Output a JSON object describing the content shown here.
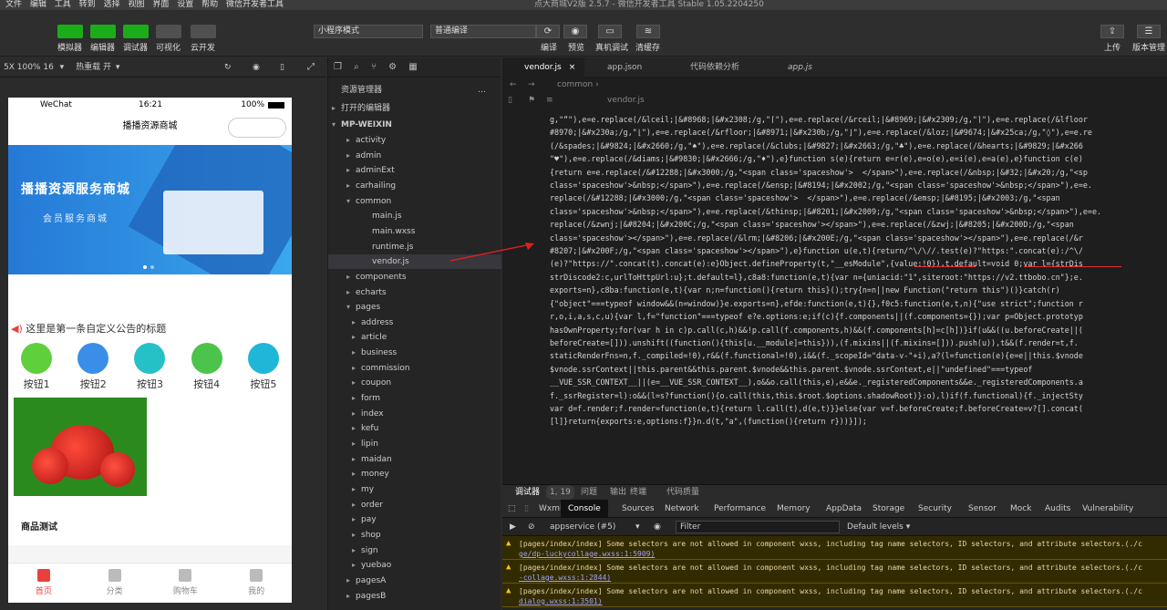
{
  "menubar": {
    "items": [
      "文件",
      "编辑",
      "工具",
      "转到",
      "选择",
      "视图",
      "界面",
      "设置",
      "帮助",
      "微信开发者工具"
    ],
    "title": "点大商城V2版 2.5.7 - 微信开发者工具 Stable 1.05.2204250"
  },
  "toolbar": {
    "left_labels": [
      "模拟器",
      "编辑器",
      "调试器",
      "可视化",
      "云开发"
    ],
    "mode_select": "小程序模式",
    "compile_select": "普通编译",
    "mid_labels": [
      "编译",
      "预览",
      "真机调试",
      "清缓存"
    ],
    "right_labels": [
      "上传",
      "版本管理"
    ]
  },
  "simbar": {
    "device": "5X 100% 16",
    "hotreload": "热重载 开"
  },
  "phone": {
    "carrier": "WeChat",
    "time": "16:21",
    "battery": "100%",
    "nav_title": "播播资源商城",
    "banner_title": "播播资源服务商城",
    "banner_sub": "会员服务商城",
    "notice": "这里是第一条自定义公告的标题",
    "buttons": [
      "按钮1",
      "按钮2",
      "按钮3",
      "按钮4",
      "按钮5"
    ],
    "product_title": "商品测试",
    "tabs": [
      "首页",
      "分类",
      "购物车",
      "我的"
    ]
  },
  "explorer": {
    "title": "资源管理器",
    "open_editors": "打开的编辑器",
    "project": "MP-WEIXIN",
    "items": [
      "activity",
      "admin",
      "adminExt",
      "carhailing",
      "common",
      "main.js",
      "main.wxss",
      "runtime.js",
      "vendor.js",
      "components",
      "echarts",
      "pages",
      "address",
      "article",
      "business",
      "commission",
      "coupon",
      "form",
      "index",
      "kefu",
      "lipin",
      "maidan",
      "money",
      "my",
      "order",
      "pay",
      "shop",
      "sign",
      "yuebao",
      "pagesA",
      "pagesB"
    ]
  },
  "editor": {
    "tabs": [
      "vendor.js",
      "app.json",
      "代码依赖分析",
      "app.js"
    ],
    "crumb": [
      "common",
      "vendor.js"
    ],
    "code": [
      "g,\"“\"),e=e.replace(/&lceil;|&#8968;|&#x2308;/g,\"⌈\"),e=e.replace(/&rceil;|&#8969;|&#x2309;/g,\"⌉\"),e=e.replace(/&lfloor",
      "#8970;|&#x230a;/g,\"⌊\"),e=e.replace(/&rfloor;|&#8971;|&#x230b;/g,\"⌋\"),e=e.replace(/&loz;|&#9674;|&#x25ca;/g,\"◊\"),e=e.re",
      "(/&spades;|&#9824;|&#x2660;/g,\"♠\"),e=e.replace(/&clubs;|&#9827;|&#x2663;/g,\"♣\"),e=e.replace(/&hearts;|&#9829;|&#x266",
      "\"♥\"),e=e.replace(/&diams;|&#9830;|&#x2666;/g,\"♦\"),e}function s(e){return e=r(e),e=o(e),e=i(e),e=a(e),e}function c(e)",
      "{return e=e.replace(/&#12288;|&#x3000;/g,\"<span class='spaceshow'>  </span>\"),e=e.replace(/&nbsp;|&#32;|&#x20;/g,\"<sp",
      "class='spaceshow'>&nbsp;</span>\"),e=e.replace(/&ensp;|&#8194;|&#x2002;/g,\"<span class='spaceshow'>&nbsp;</span>\"),e=e.",
      "replace(/&#12288;|&#x3000;/g,\"<span class='spaceshow'>  </span>\"),e=e.replace(/&emsp;|&#8195;|&#x2003;/g,\"<span",
      "class='spaceshow'>&nbsp;</span>\"),e=e.replace(/&thinsp;|&#8201;|&#x2009;/g,\"<span class='spaceshow'>&nbsp;</span>\"),e=e.",
      "replace(/&zwnj;|&#8204;|&#x200C;/g,\"<span class='spaceshow'></span>\"),e=e.replace(/&zwj;|&#8205;|&#x200D;/g,\"<span",
      "class='spaceshow'></span>\"),e=e.replace(/&lrm;|&#8206;|&#x200E;/g,\"<span class='spaceshow'></span>\"),e=e.replace(/&r",
      "#8207;|&#x200F;/g,\"<span class='spaceshow'></span>\"),e}function u(e,t){return/^\\/\\//.test(e)?\"https:\".concat(e):/^\\/",
      "(e)?\"https://\".concat(t).concat(e):e}Object.defineProperty(t,\"__esModule\",{value:!0}),t.default=void 0;var l={strDis",
      "strDiscode2:c,urlToHttpUrl:u};t.default=l},c8a8:function(e,t){var n={uniacid:\"1\",siteroot:\"https://v2.ttbobo.cn\"};e.",
      "exports=n},c8ba:function(e,t){var n;n=function(){return this}();try{n=n||new Function(\"return this\")()}catch(r)",
      "{\"object\"===typeof window&&(n=window)}e.exports=n},efde:function(e,t){},f0c5:function(e,t,n){\"use strict\";function r",
      "r,o,i,a,s,c,u){var l,f=\"function\"===typeof e?e.options:e;if(c){f.components||(f.components={});var p=Object.prototyp",
      "hasOwnProperty;for(var h in c)p.call(c,h)&&!p.call(f.components,h)&&(f.components[h]=c[h])}if(u&&((u.beforeCreate||(",
      "beforeCreate=[])).unshift((function(){this[u.__module]=this})),(f.mixins||(f.mixins=[])).push(u)),t&&(f.render=t,f.",
      "staticRenderFns=n,f._compiled=!0),r&&(f.functional=!0),i&&(f._scopeId=\"data-v-\"+i),a?(l=function(e){e=e||this.$vnode",
      "$vnode.ssrContext||this.parent&&this.parent.$vnode&&this.parent.$vnode.ssrContext,e||\"undefined\"===typeof",
      "__VUE_SSR_CONTEXT__||(e=__VUE_SSR_CONTEXT__),o&&o.call(this,e),e&&e._registeredComponents&&e._registeredComponents.a",
      "f._ssrRegister=l):o&&(l=s?function(){o.call(this,this.$root.$options.shadowRoot)}:o),l)if(f.functional){f._injectSty",
      "var d=f.render;f.render=function(e,t){return l.call(t),d(e,t)}}else{var v=f.beforeCreate;f.beforeCreate=v?[].concat(",
      "[l]}return{exports:e,options:f}}n.d(t,\"a\",(function(){return r}))}]);"
    ]
  },
  "devtools": {
    "top_tabs": [
      "调试器",
      "1, 19",
      "问题",
      "输出",
      "终端",
      "代码质量"
    ],
    "panel_tabs": [
      "Wxml",
      "Console",
      "Sources",
      "Network",
      "Performance",
      "Memory",
      "AppData",
      "Storage",
      "Security",
      "Sensor",
      "Mock",
      "Audits",
      "Vulnerability"
    ],
    "context": "appservice (#5)",
    "filter_placeholder": "Filter",
    "levels": "Default levels",
    "warnings": [
      {
        "text": "[pages/index/index] Some selectors are not allowed in component wxss, including tag name selectors, ID selectors, and attribute selectors.(./c",
        "file": "ge/dp-luckycollage.wxss:1:5909)"
      },
      {
        "text": "[pages/index/index] Some selectors are not allowed in component wxss, including tag name selectors, ID selectors, and attribute selectors.(./c",
        "file": "-collage.wxss:1:2844)"
      },
      {
        "text": "[pages/index/index] Some selectors are not allowed in component wxss, including tag name selectors, ID selectors, and attribute selectors.(./c",
        "file": "dialog.wxss:1:3501)"
      }
    ]
  }
}
